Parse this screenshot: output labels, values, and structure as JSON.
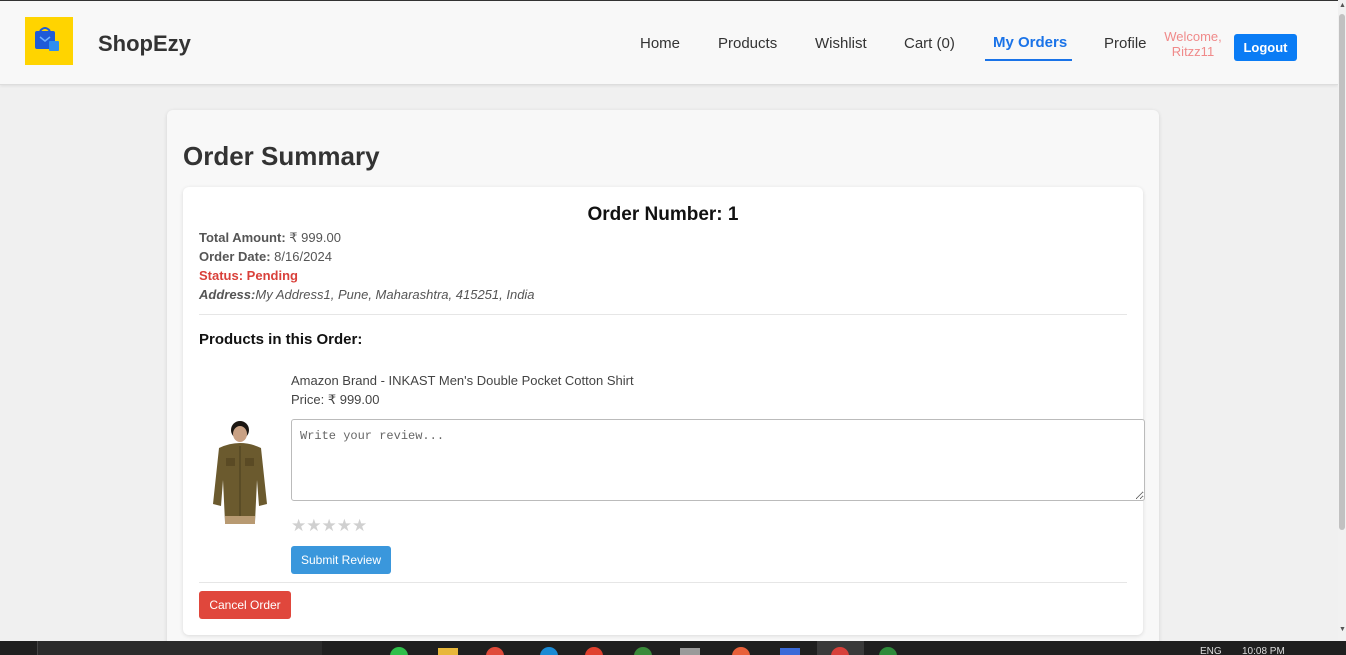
{
  "header": {
    "brand": "ShopEzy",
    "nav": {
      "home": "Home",
      "products": "Products",
      "wishlist": "Wishlist",
      "cart": "Cart (0)",
      "my_orders": "My Orders",
      "profile": "Profile"
    },
    "welcome": "Welcome, Ritzz11",
    "logout": "Logout",
    "active_color": "#1a73e8",
    "logo_color": "#ffd400"
  },
  "main": {
    "title": "Order Summary",
    "order": {
      "number_label": "Order Number: 1",
      "total_label": "Total Amount:",
      "total_value": "₹ 999.00",
      "date_label": "Order Date:",
      "date_value": "8/16/2024",
      "status_label": "Status: Pending",
      "address_label": "Address:",
      "address_value": "My Address1, Pune, Maharashtra, 415251, India",
      "products_heading": "Products in this Order:",
      "products": [
        {
          "name": "Amazon Brand - INKAST Men's Double Pocket Cotton Shirt",
          "price": "Price: ₹ 999.00",
          "review_placeholder": "Write your review...",
          "rating": 0,
          "stars": "★★★★★",
          "submit_label": "Submit Review"
        }
      ],
      "cancel_label": "Cancel Order",
      "status_color": "#d9403a"
    }
  },
  "taskbar": {
    "lang": "ENG",
    "time": "10:08 PM"
  }
}
